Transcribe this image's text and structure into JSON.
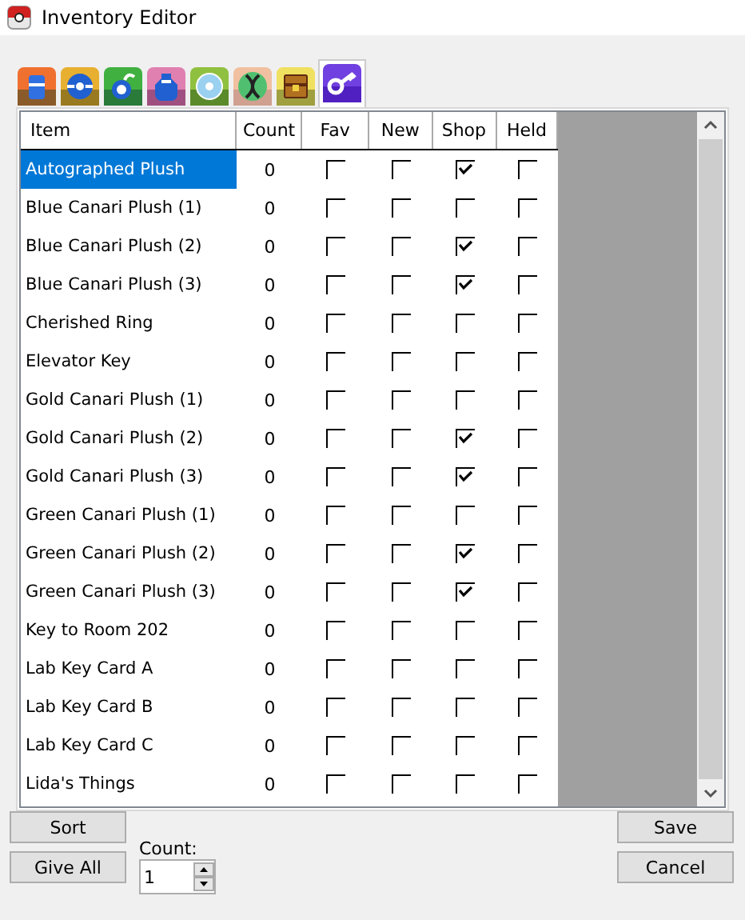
{
  "window": {
    "title": "Inventory Editor"
  },
  "tabs": [
    {
      "kind": "bag",
      "selected": false
    },
    {
      "kind": "ball",
      "selected": false
    },
    {
      "kind": "berry",
      "selected": false
    },
    {
      "kind": "potion",
      "selected": false
    },
    {
      "kind": "disc",
      "selected": false
    },
    {
      "kind": "dna",
      "selected": false
    },
    {
      "kind": "chest",
      "selected": false
    },
    {
      "kind": "key",
      "selected": true
    }
  ],
  "table": {
    "columns": [
      "Item",
      "Count",
      "Fav",
      "New",
      "Shop",
      "Held"
    ],
    "rows": [
      {
        "item": "Autographed Plush",
        "count": "0",
        "fav": false,
        "new": false,
        "shop": true,
        "held": false,
        "selected": true
      },
      {
        "item": "Blue Canari Plush (1)",
        "count": "0",
        "fav": false,
        "new": false,
        "shop": false,
        "held": false,
        "selected": false
      },
      {
        "item": "Blue Canari Plush (2)",
        "count": "0",
        "fav": false,
        "new": false,
        "shop": true,
        "held": false,
        "selected": false
      },
      {
        "item": "Blue Canari Plush (3)",
        "count": "0",
        "fav": false,
        "new": false,
        "shop": true,
        "held": false,
        "selected": false
      },
      {
        "item": "Cherished Ring",
        "count": "0",
        "fav": false,
        "new": false,
        "shop": false,
        "held": false,
        "selected": false
      },
      {
        "item": "Elevator Key",
        "count": "0",
        "fav": false,
        "new": false,
        "shop": false,
        "held": false,
        "selected": false
      },
      {
        "item": "Gold Canari Plush (1)",
        "count": "0",
        "fav": false,
        "new": false,
        "shop": false,
        "held": false,
        "selected": false
      },
      {
        "item": "Gold Canari Plush (2)",
        "count": "0",
        "fav": false,
        "new": false,
        "shop": true,
        "held": false,
        "selected": false
      },
      {
        "item": "Gold Canari Plush (3)",
        "count": "0",
        "fav": false,
        "new": false,
        "shop": true,
        "held": false,
        "selected": false
      },
      {
        "item": "Green Canari Plush (1)",
        "count": "0",
        "fav": false,
        "new": false,
        "shop": false,
        "held": false,
        "selected": false
      },
      {
        "item": "Green Canari Plush (2)",
        "count": "0",
        "fav": false,
        "new": false,
        "shop": true,
        "held": false,
        "selected": false
      },
      {
        "item": "Green Canari Plush (3)",
        "count": "0",
        "fav": false,
        "new": false,
        "shop": true,
        "held": false,
        "selected": false
      },
      {
        "item": "Key to Room 202",
        "count": "0",
        "fav": false,
        "new": false,
        "shop": false,
        "held": false,
        "selected": false
      },
      {
        "item": "Lab Key Card A",
        "count": "0",
        "fav": false,
        "new": false,
        "shop": false,
        "held": false,
        "selected": false
      },
      {
        "item": "Lab Key Card B",
        "count": "0",
        "fav": false,
        "new": false,
        "shop": false,
        "held": false,
        "selected": false
      },
      {
        "item": "Lab Key Card C",
        "count": "0",
        "fav": false,
        "new": false,
        "shop": false,
        "held": false,
        "selected": false
      },
      {
        "item": "Lida's Things",
        "count": "0",
        "fav": false,
        "new": false,
        "shop": false,
        "held": false,
        "selected": false
      }
    ]
  },
  "buttons": {
    "sort": "Sort",
    "give_all": "Give All",
    "save": "Save",
    "cancel": "Cancel"
  },
  "count_field": {
    "label": "Count:",
    "value": "1"
  }
}
